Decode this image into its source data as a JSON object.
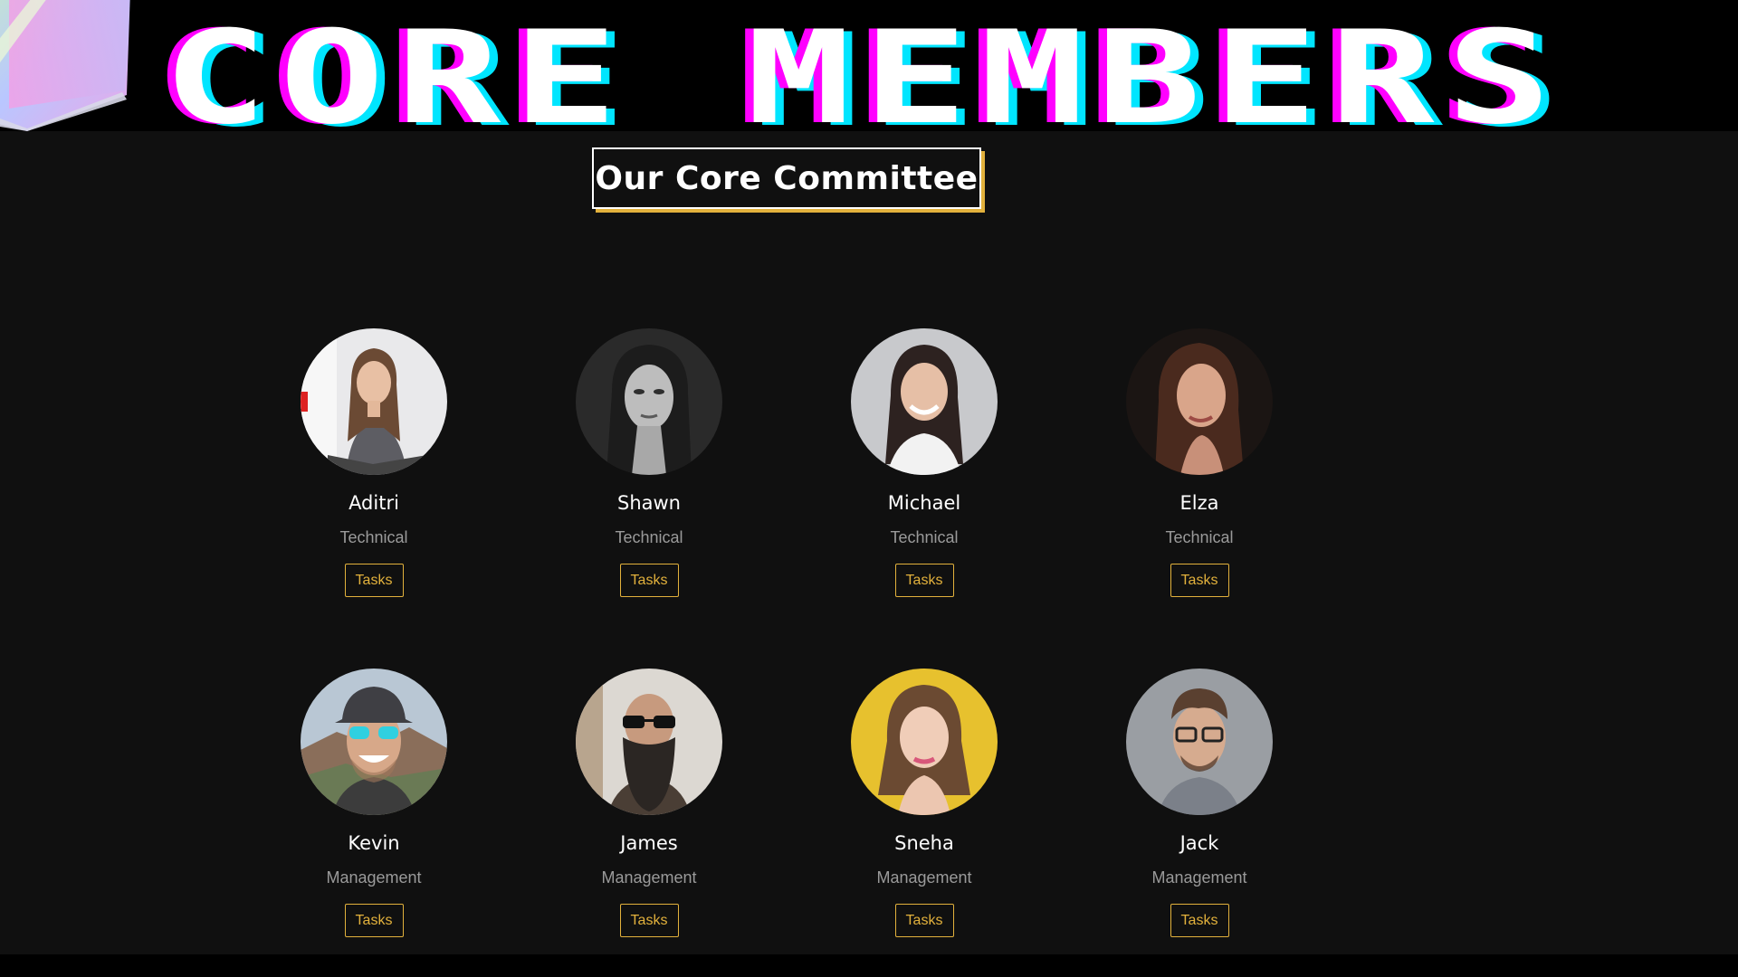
{
  "banner": {
    "title": "CORE MEMBERS"
  },
  "section": {
    "heading": "Our Core Committee"
  },
  "colors": {
    "accent": "#e2b13c",
    "glitch_magenta": "#ff00ff",
    "glitch_cyan": "#00e5ff",
    "background": "#101010"
  },
  "members": [
    {
      "name": "Aditri",
      "role": "Technical",
      "button": "Tasks",
      "photo": "portrait-woman-long-hair-office"
    },
    {
      "name": "Shawn",
      "role": "Technical",
      "button": "Tasks",
      "photo": "portrait-woman-black-and-white"
    },
    {
      "name": "Michael",
      "role": "Technical",
      "button": "Tasks",
      "photo": "portrait-woman-smiling-dark-hair"
    },
    {
      "name": "Elza",
      "role": "Technical",
      "button": "Tasks",
      "photo": "portrait-woman-wavy-brown-hair"
    },
    {
      "name": "Kevin",
      "role": "Management",
      "button": "Tasks",
      "photo": "portrait-man-cap-sunglasses"
    },
    {
      "name": "James",
      "role": "Management",
      "button": "Tasks",
      "photo": "portrait-man-beard-sunglasses"
    },
    {
      "name": "Sneha",
      "role": "Management",
      "button": "Tasks",
      "photo": "portrait-woman-yellow-background"
    },
    {
      "name": "Jack",
      "role": "Management",
      "button": "Tasks",
      "photo": "portrait-man-glasses-beard"
    }
  ]
}
